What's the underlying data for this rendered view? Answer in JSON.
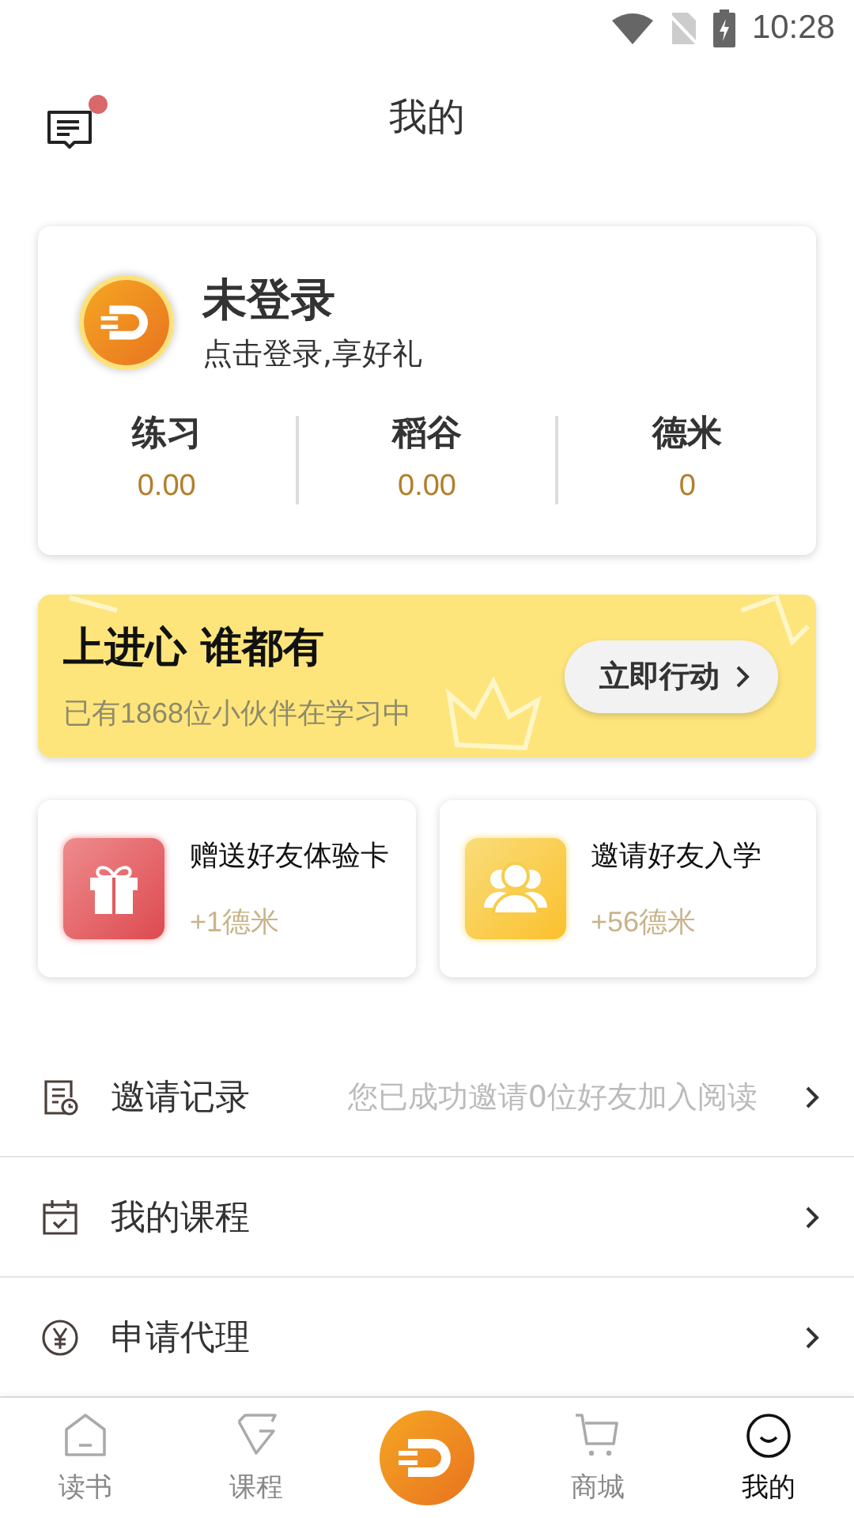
{
  "status_bar": {
    "time": "10:28"
  },
  "header": {
    "title": "我的",
    "has_unread": true
  },
  "profile": {
    "name": "未登录",
    "subtitle": "点击登录,享好礼",
    "stats": [
      {
        "label": "练习",
        "value": "0.00"
      },
      {
        "label": "稻谷",
        "value": "0.00"
      },
      {
        "label": "德米",
        "value": "0"
      }
    ]
  },
  "banner": {
    "title": "上进心 谁都有",
    "subtitle": "已有1868位小伙伴在学习中",
    "button": "立即行动"
  },
  "rewards": [
    {
      "kind": "gift",
      "title": "赠送好友体验卡",
      "reward": "+1德米"
    },
    {
      "kind": "group",
      "title": "邀请好友入学",
      "reward": "+56德米"
    }
  ],
  "menu": [
    {
      "kind": "record",
      "label": "邀请记录",
      "detail": "您已成功邀请0位好友加入阅读"
    },
    {
      "kind": "course",
      "label": "我的课程"
    },
    {
      "kind": "agent",
      "label": "申请代理"
    }
  ],
  "nav": [
    {
      "kind": "home",
      "label": "读书",
      "selected": false
    },
    {
      "kind": "course",
      "label": "课程",
      "selected": false
    },
    {
      "kind": "logo"
    },
    {
      "kind": "cart",
      "label": "商城",
      "selected": false
    },
    {
      "kind": "face",
      "label": "我的",
      "selected": true
    }
  ]
}
